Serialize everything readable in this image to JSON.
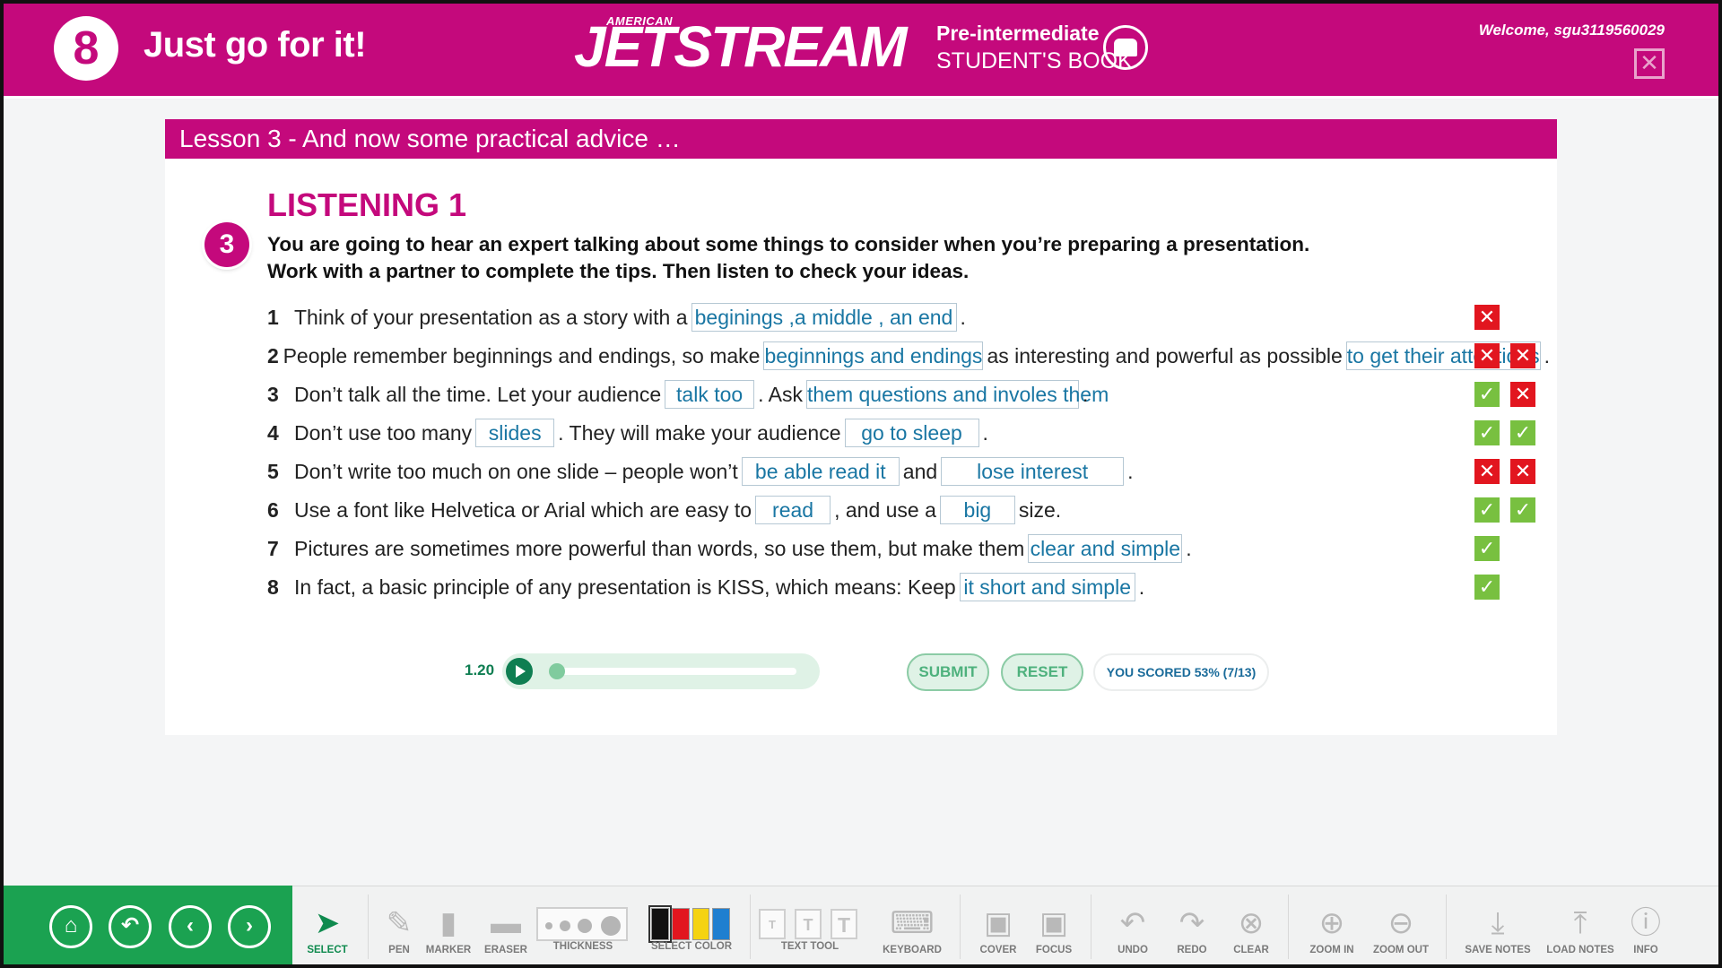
{
  "header": {
    "unit_number": "8",
    "unit_title": "Just go for it!",
    "brand_small": "AMERICAN",
    "brand": "JETSTREAM",
    "level": "Pre-intermediate",
    "book": "STUDENT'S BOOK",
    "welcome": "Welcome, sgu3119560029",
    "close": "✕"
  },
  "lesson": {
    "title": "Lesson 3 - And now some practical advice …"
  },
  "exercise": {
    "section": "LISTENING 1",
    "number": "3",
    "instruction_1": "You are going to hear an expert talking about some things to consider when you’re preparing a presentation.",
    "instruction_2": "Work with a partner to complete the tips. Then listen to check your ideas.",
    "questions": [
      {
        "n": "1",
        "t1": "Think of your presentation as a story with a",
        "a1": "beginings ,a middle , an end",
        "t2": "."
      },
      {
        "n": "2",
        "t1": "People remember beginnings and endings, so make",
        "a1": "beginnings and endings",
        "t2": "as interesting and powerful as possible",
        "a2": "to get their attentions",
        "t3": "."
      },
      {
        "n": "3",
        "t1": "Don’t talk all the time. Let your audience",
        "a1": "talk too",
        "t2": ". Ask",
        "a2": "them questions and involes them",
        "t3": "."
      },
      {
        "n": "4",
        "t1": "Don’t use too many",
        "a1": "slides",
        "t2": ". They will make your audience",
        "a2": "go to sleep",
        "t3": "."
      },
      {
        "n": "5",
        "t1": "Don’t write too much on one slide – people won’t",
        "a1": "be able read it",
        "t2": "and",
        "a2": "lose interest",
        "t3": "."
      },
      {
        "n": "6",
        "t1": "Use a font like Helvetica or Arial which are easy to",
        "a1": "read",
        "t2": ", and use a",
        "a2": "big",
        "t3": "size."
      },
      {
        "n": "7",
        "t1": "Pictures are sometimes more powerful than words, so use them, but make them",
        "a1": "clear and simple",
        "t2": "."
      },
      {
        "n": "8",
        "t1": "In fact, a basic principle of any presentation is KISS, which means: Keep",
        "a1": "it short and simple",
        "t2": "."
      }
    ],
    "results": [
      [
        "wrong"
      ],
      [
        "wrong",
        "wrong"
      ],
      [
        "right",
        "wrong"
      ],
      [
        "right",
        "right"
      ],
      [
        "wrong",
        "wrong"
      ],
      [
        "right",
        "right"
      ],
      [
        "right"
      ],
      [
        "right"
      ]
    ]
  },
  "audio": {
    "track": "1.20",
    "progress": 0
  },
  "actions": {
    "submit": "SUBMIT",
    "reset": "RESET",
    "score": "YOU SCORED 53% (7/13)"
  },
  "toolbar": {
    "nav": [
      "home-icon",
      "back-icon",
      "previous-icon",
      "next-icon"
    ],
    "select": "SELECT",
    "pen": "PEN",
    "marker": "MARKER",
    "eraser": "ERASER",
    "thickness": "THICKNESS",
    "select_color": "SELECT COLOR",
    "text_tool": "TEXT TOOL",
    "keyboard": "KEYBOARD",
    "cover": "COVER",
    "focus": "FOCUS",
    "undo": "UNDO",
    "redo": "REDO",
    "clear": "CLEAR",
    "zoom_in": "ZOOM IN",
    "zoom_out": "ZOOM OUT",
    "save_notes": "SAVE NOTES",
    "load_notes": "LOAD NOTES",
    "info": "INFO",
    "text_sizes": [
      "T",
      "T",
      "T"
    ]
  },
  "colors": {
    "brand": "#c4097c",
    "nav": "#1ba251",
    "answer_text": "#1976a3",
    "wrong": "#e2161f",
    "right": "#78c040",
    "swatches": [
      "#111111",
      "#e2161f",
      "#f5d312",
      "#1f7fd0"
    ]
  }
}
